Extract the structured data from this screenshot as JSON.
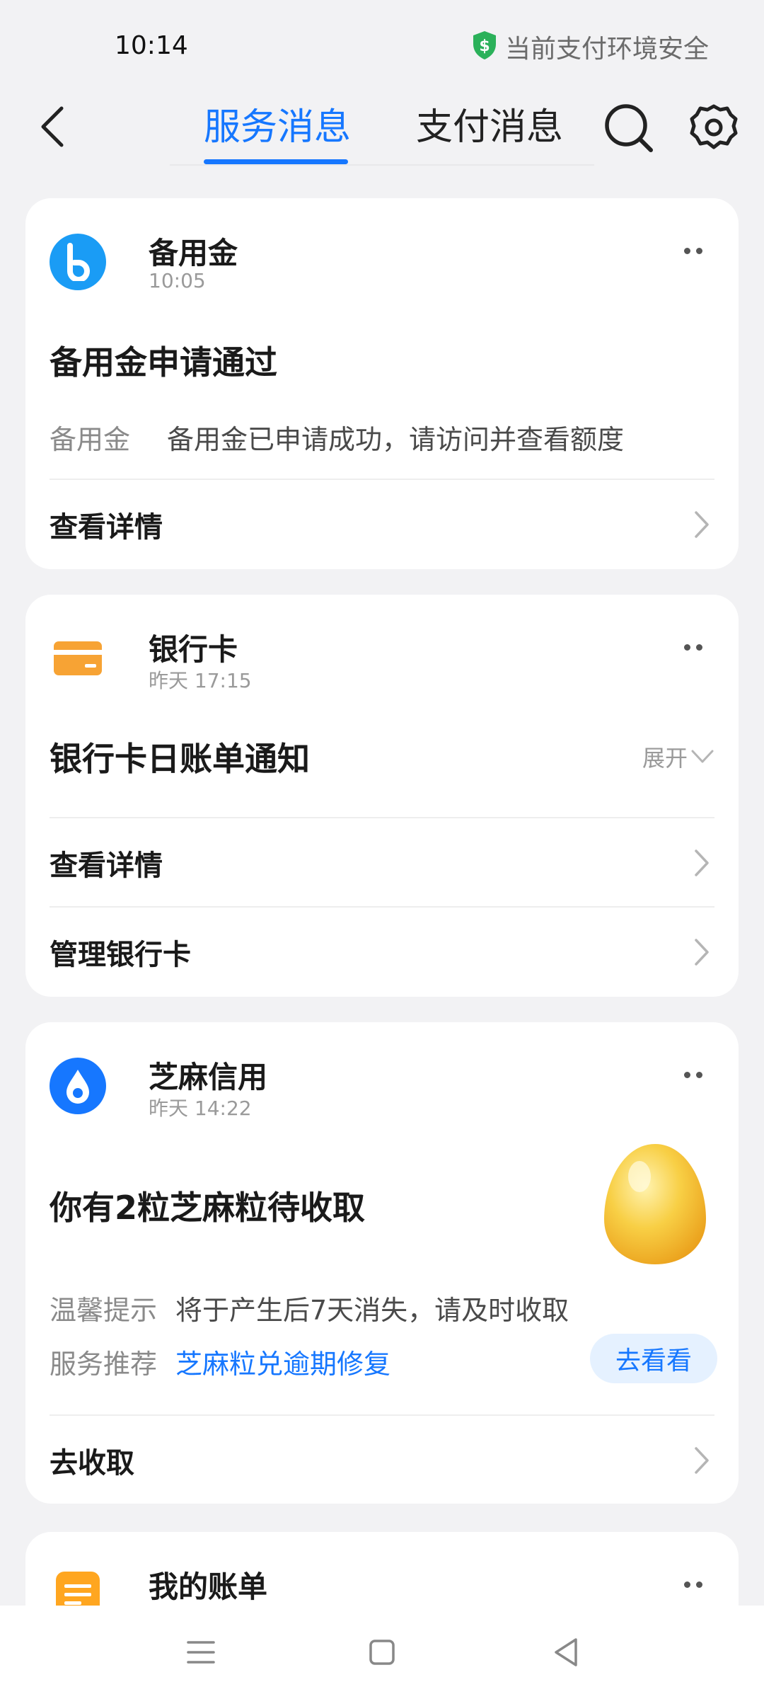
{
  "status_bar": {
    "time": "10:14",
    "secure_text": "当前支付环境安全"
  },
  "header": {
    "tabs": [
      {
        "label": "服务消息",
        "active": true
      },
      {
        "label": "支付消息",
        "active": false
      }
    ]
  },
  "cards": [
    {
      "name": "备用金",
      "time": "10:05",
      "title": "备用金申请通过",
      "rows": [
        {
          "key": "备用金",
          "value": "备用金已申请成功，请访问并查看额度"
        }
      ],
      "actions": [
        {
          "label": "查看详情"
        }
      ]
    },
    {
      "name": "银行卡",
      "time": "昨天 17:15",
      "title": "银行卡日账单通知",
      "expand_label": "展开",
      "actions": [
        {
          "label": "查看详情"
        },
        {
          "label": "管理银行卡"
        }
      ]
    },
    {
      "name": "芝麻信用",
      "time": "昨天 14:22",
      "title": "你有2粒芝麻粒待收取",
      "rows": [
        {
          "key": "温馨提示",
          "value": "将于产生后7天消失，请及时收取"
        },
        {
          "key": "服务推荐",
          "value": "芝麻粒兑逾期修复"
        }
      ],
      "goto_label": "去看看",
      "actions": [
        {
          "label": "去收取"
        }
      ]
    },
    {
      "name": "我的账单"
    }
  ],
  "colors": {
    "accent": "#1677ff",
    "secure_green": "#2bb15a",
    "card_orange": "#f7a334"
  }
}
